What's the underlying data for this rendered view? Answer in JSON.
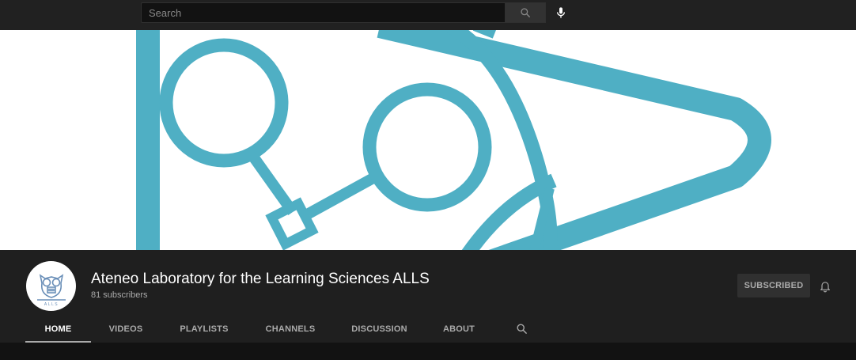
{
  "search": {
    "placeholder": "Search"
  },
  "icons": {
    "search": "search-icon",
    "mic": "microphone-icon",
    "bell": "bell-icon",
    "tab_search": "search-icon"
  },
  "colors": {
    "banner_accent": "#4fafc4",
    "topbar": "#212121",
    "header": "#1f1f1f"
  },
  "channel": {
    "name": "Ateneo Laboratory for the Learning Sciences ALLS",
    "subscribers": "81 subscribers",
    "avatar_text": "ALLS",
    "subscribe_label": "SUBSCRIBED"
  },
  "tabs": [
    {
      "label": "HOME",
      "active": true
    },
    {
      "label": "VIDEOS"
    },
    {
      "label": "PLAYLISTS"
    },
    {
      "label": "CHANNELS"
    },
    {
      "label": "DISCUSSION"
    },
    {
      "label": "ABOUT"
    }
  ]
}
